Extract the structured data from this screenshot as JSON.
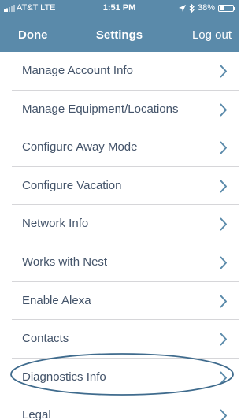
{
  "status_bar": {
    "carrier": "AT&T  LTE",
    "time": "1:51 PM",
    "battery": "38%",
    "battery_level": 0.38
  },
  "nav": {
    "left_button": "Done",
    "title": "Settings",
    "right_button": "Log out"
  },
  "menu": {
    "items": [
      {
        "label": "Manage Account Info"
      },
      {
        "label": "Manage Equipment/Locations"
      },
      {
        "label": "Configure Away Mode"
      },
      {
        "label": "Configure Vacation"
      },
      {
        "label": "Network Info"
      },
      {
        "label": "Works with Nest"
      },
      {
        "label": "Enable Alexa"
      },
      {
        "label": "Contacts"
      },
      {
        "label": "Diagnostics Info"
      },
      {
        "label": "Legal"
      }
    ],
    "chevron_icon": "chevron-right-icon",
    "highlighted_item": "Diagnostics Info"
  },
  "colors": {
    "header_background": "#5a8aaa",
    "chevron": "#5a8aaa",
    "row_text": "#44546a",
    "highlight_outline": "#3f6b8d"
  }
}
